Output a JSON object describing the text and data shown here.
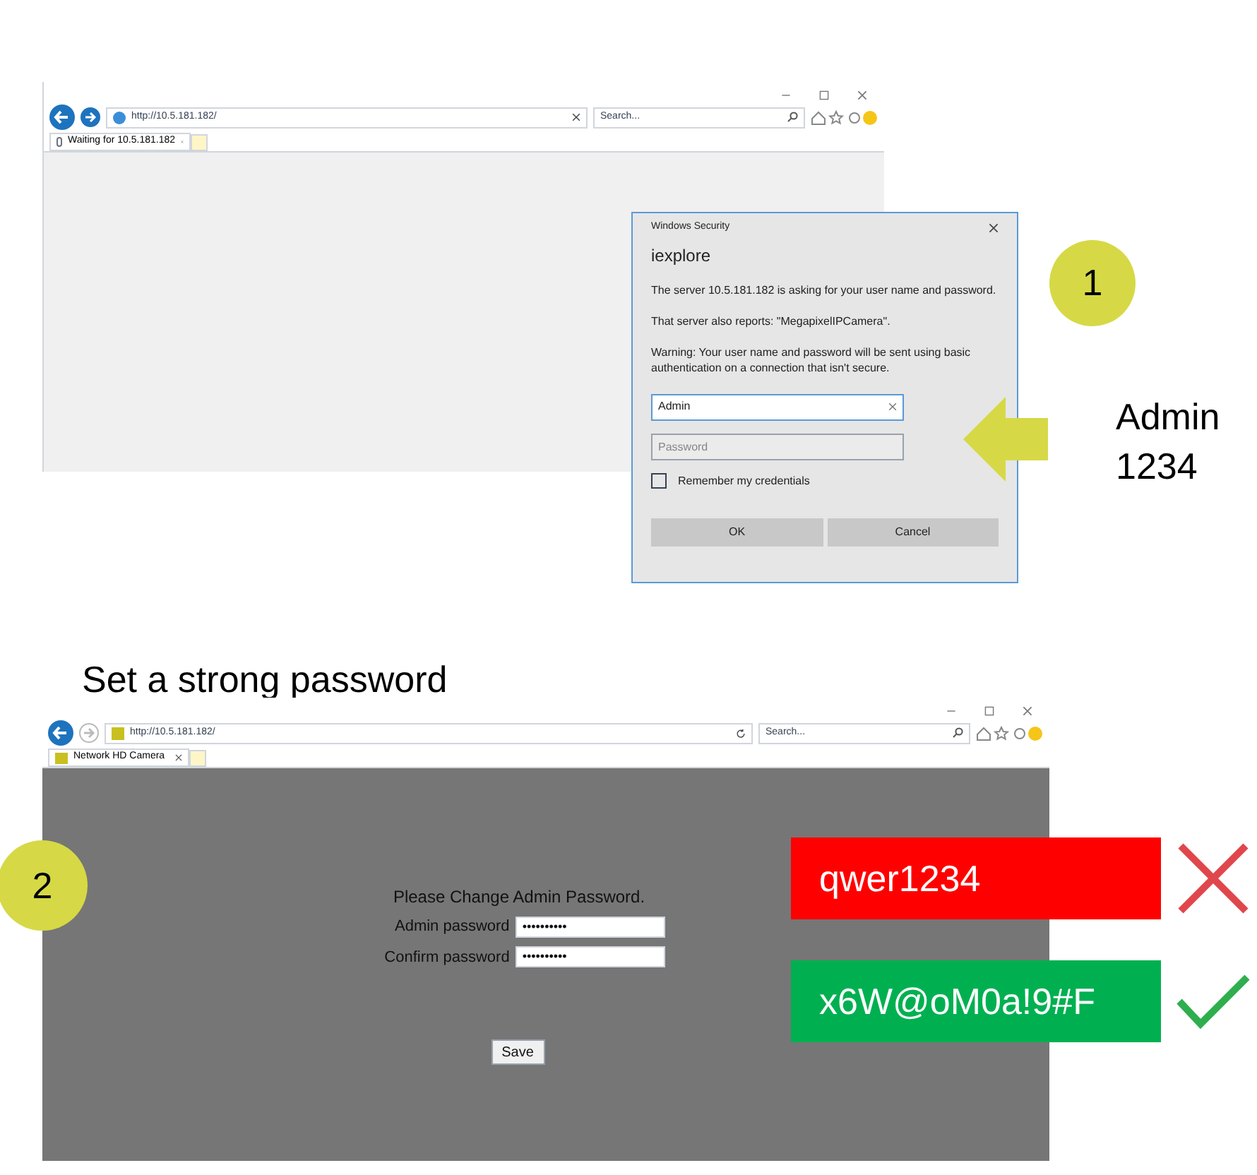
{
  "step_1": {
    "badge": "1",
    "browser": {
      "address": "http://10.5.181.182/",
      "search_placeholder": "Search...",
      "tab": {
        "title": "Waiting for 10.5.181.182",
        "loading": true
      }
    },
    "dialog": {
      "title": "Windows Security",
      "app": "iexplore",
      "paragraphs": [
        "The server 10.5.181.182 is asking for your user name and password.",
        "That server also reports: \"MegapixelIPCamera\".",
        "Warning: Your user name and password will be sent using basic authentication on a connection that isn't secure."
      ],
      "username": {
        "value": "Admin"
      },
      "password": {
        "placeholder": "Password"
      },
      "remember": {
        "label": "Remember my credentials",
        "checked": false
      },
      "buttons": [
        "OK",
        "Cancel"
      ]
    },
    "credentials": [
      "Admin",
      "1234"
    ]
  },
  "step_2": {
    "heading": "Set a strong password",
    "badge": "2",
    "browser": {
      "address": "http://10.5.181.182/",
      "search_placeholder": "Search...",
      "tab": {
        "title": "Network HD Camera",
        "loading": false
      }
    },
    "form": {
      "title": "Please Change Admin Password.",
      "fields": [
        {
          "label": "Admin password",
          "value": "••••••••••"
        },
        {
          "label": "Confirm password",
          "value": "••••••••••"
        }
      ],
      "button": "Save"
    },
    "examples": [
      {
        "text": "qwer1234",
        "kind": "bad",
        "color": "#ff0000"
      },
      {
        "text": "x6W@oM0a!9#F",
        "kind": "good",
        "color": "#00b050"
      }
    ]
  }
}
